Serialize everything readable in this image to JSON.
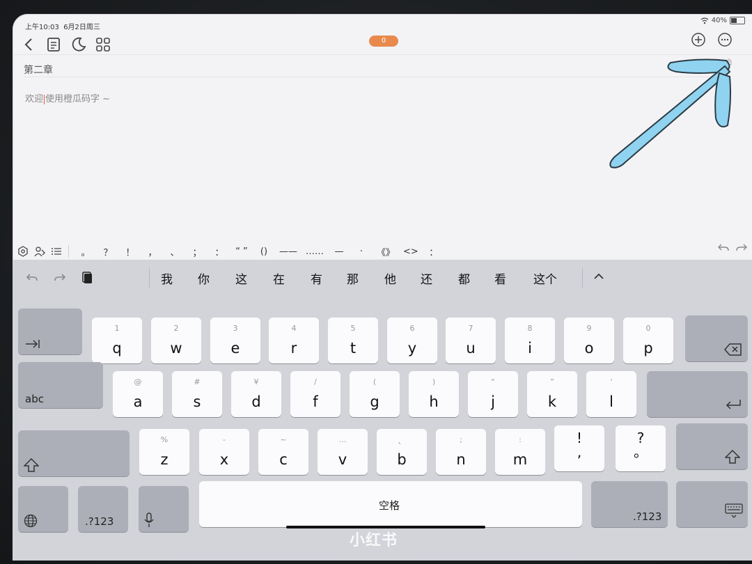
{
  "status": {
    "time": "上午10:03",
    "date": "6月2日周三",
    "battery": "40%"
  },
  "toolbar": {
    "word_count": "0"
  },
  "editor": {
    "chapter_title": "第二章",
    "placeholder_prefix": "欢迎",
    "placeholder_suffix": "使用橙瓜码字 ~"
  },
  "punct_bar": {
    "items": [
      "。",
      "？",
      "！",
      "，",
      "、",
      "；",
      "：",
      "“ ”",
      "()",
      "——",
      "……",
      "—",
      "·",
      "《》",
      "<>",
      "："
    ]
  },
  "candidates": [
    "我",
    "你",
    "这",
    "在",
    "有",
    "那",
    "他",
    "还",
    "都",
    "看",
    "这个"
  ],
  "watermark": "小红书",
  "keys": {
    "row1": [
      {
        "s": "1",
        "m": "q"
      },
      {
        "s": "2",
        "m": "w"
      },
      {
        "s": "3",
        "m": "e"
      },
      {
        "s": "4",
        "m": "r"
      },
      {
        "s": "5",
        "m": "t"
      },
      {
        "s": "6",
        "m": "y"
      },
      {
        "s": "7",
        "m": "u"
      },
      {
        "s": "8",
        "m": "i"
      },
      {
        "s": "9",
        "m": "o"
      },
      {
        "s": "0",
        "m": "p"
      }
    ],
    "row2": [
      {
        "s": "@",
        "m": "a"
      },
      {
        "s": "#",
        "m": "s"
      },
      {
        "s": "¥",
        "m": "d"
      },
      {
        "s": "/",
        "m": "f"
      },
      {
        "s": "(",
        "m": "g"
      },
      {
        "s": ")",
        "m": "h"
      },
      {
        "s": "“",
        "m": "j"
      },
      {
        "s": "”",
        "m": "k"
      },
      {
        "s": "'",
        "m": "l"
      }
    ],
    "row3": [
      {
        "s": "%",
        "m": "z"
      },
      {
        "s": "-",
        "m": "x"
      },
      {
        "s": "~",
        "m": "c"
      },
      {
        "s": "…",
        "m": "v"
      },
      {
        "s": "、",
        "m": "b"
      },
      {
        "s": ";",
        "m": "n"
      },
      {
        "s": ":",
        "m": "m"
      }
    ],
    "row3_punct": [
      {
        "top": "!",
        "bot": ","
      },
      {
        "top": "?",
        "bot": "。"
      }
    ],
    "abc": "abc",
    "num_left": ".?123",
    "num_right": ".?123",
    "space": "空格"
  },
  "colors": {
    "accent": "#e88a4d",
    "arrow": "#8fd3f0",
    "keyboard_bg": "#d3d4da"
  }
}
